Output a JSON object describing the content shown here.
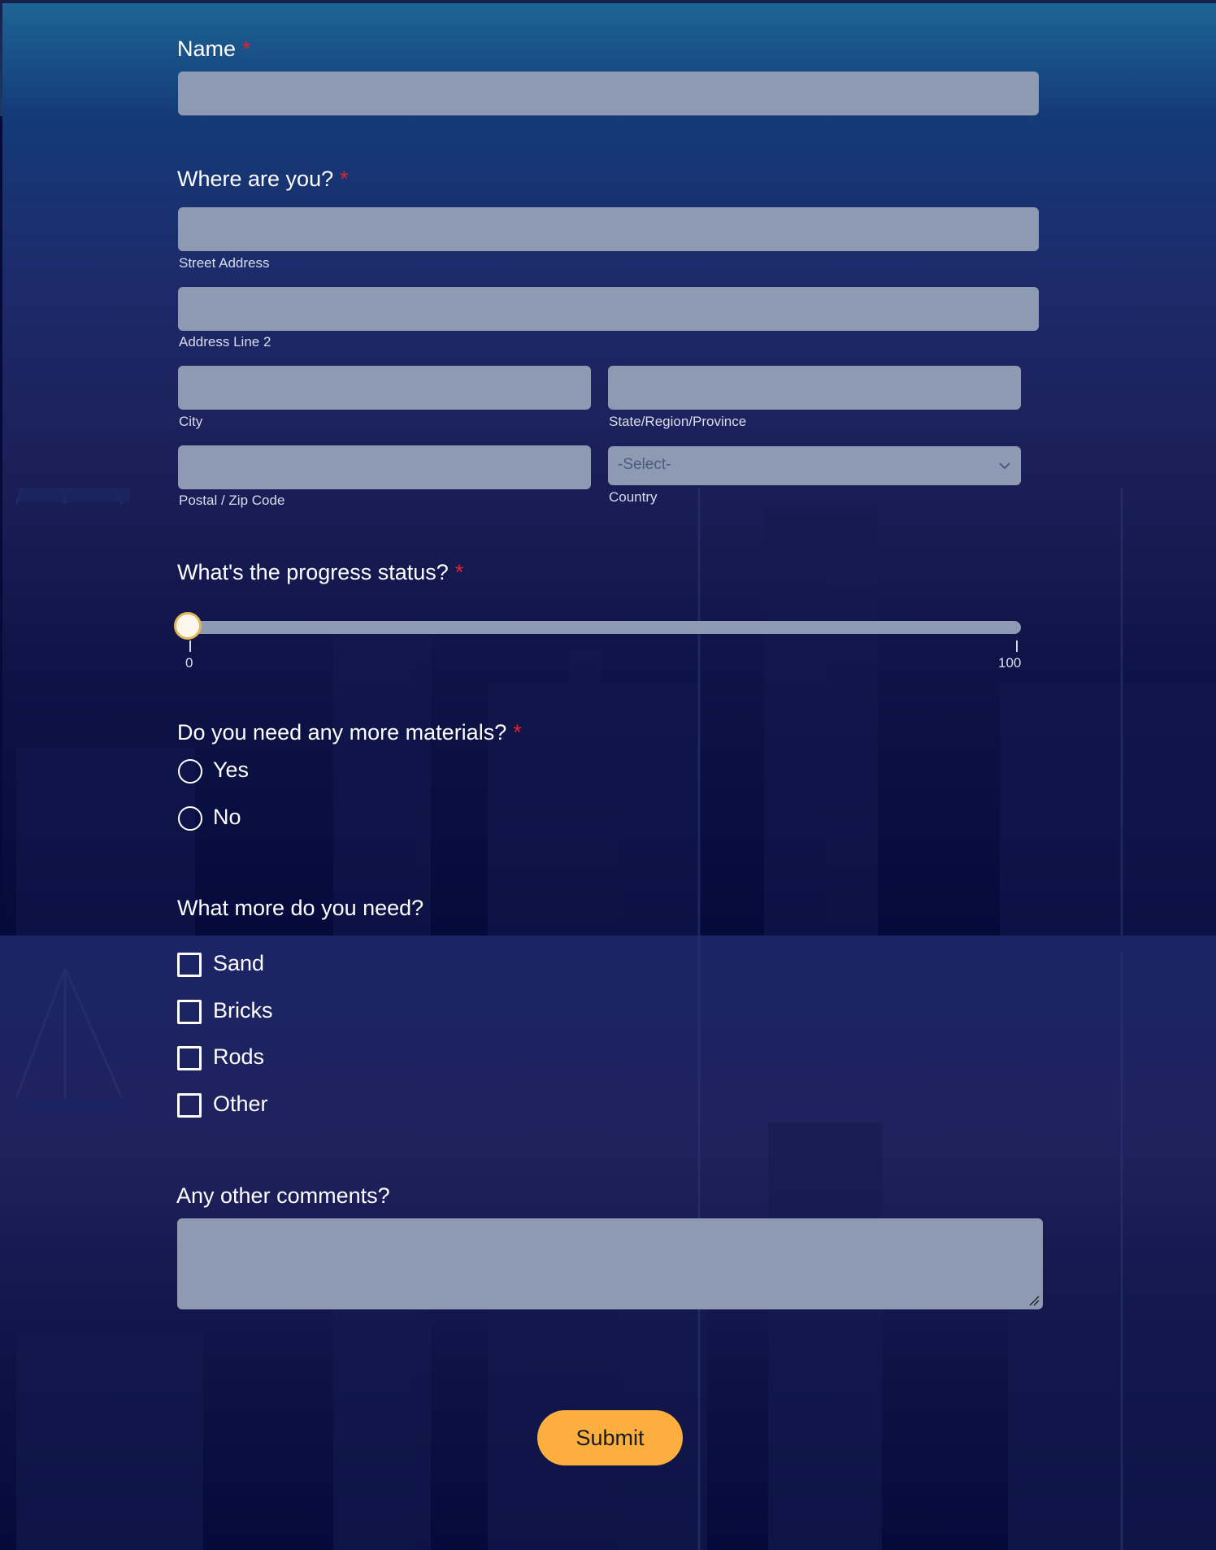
{
  "form": {
    "name": {
      "label": "Name",
      "required_mark": "*"
    },
    "location": {
      "label": "Where are you?",
      "required_mark": "*",
      "street_label": "Street Address",
      "line2_label": "Address Line 2",
      "city_label": "City",
      "state_label": "State/Region/Province",
      "postal_label": "Postal / Zip Code",
      "country_label": "Country",
      "country_selected": "-Select-"
    },
    "progress": {
      "label": "What's the progress status?",
      "required_mark": "*",
      "min_label": "0",
      "max_label": "100",
      "value": 0
    },
    "materials": {
      "label": "Do you need any more materials?",
      "required_mark": "*",
      "options": [
        "Yes",
        "No"
      ]
    },
    "needs": {
      "label": "What more do you need?",
      "options": [
        "Sand",
        "Bricks",
        "Rods",
        "Other"
      ]
    },
    "comments": {
      "label": "Any other comments?"
    },
    "submit_label": "Submit"
  },
  "colors": {
    "accent": "#fcae3f",
    "required": "#e8202a",
    "field_bg": "#8e9ab2",
    "background": "#040a3a"
  }
}
